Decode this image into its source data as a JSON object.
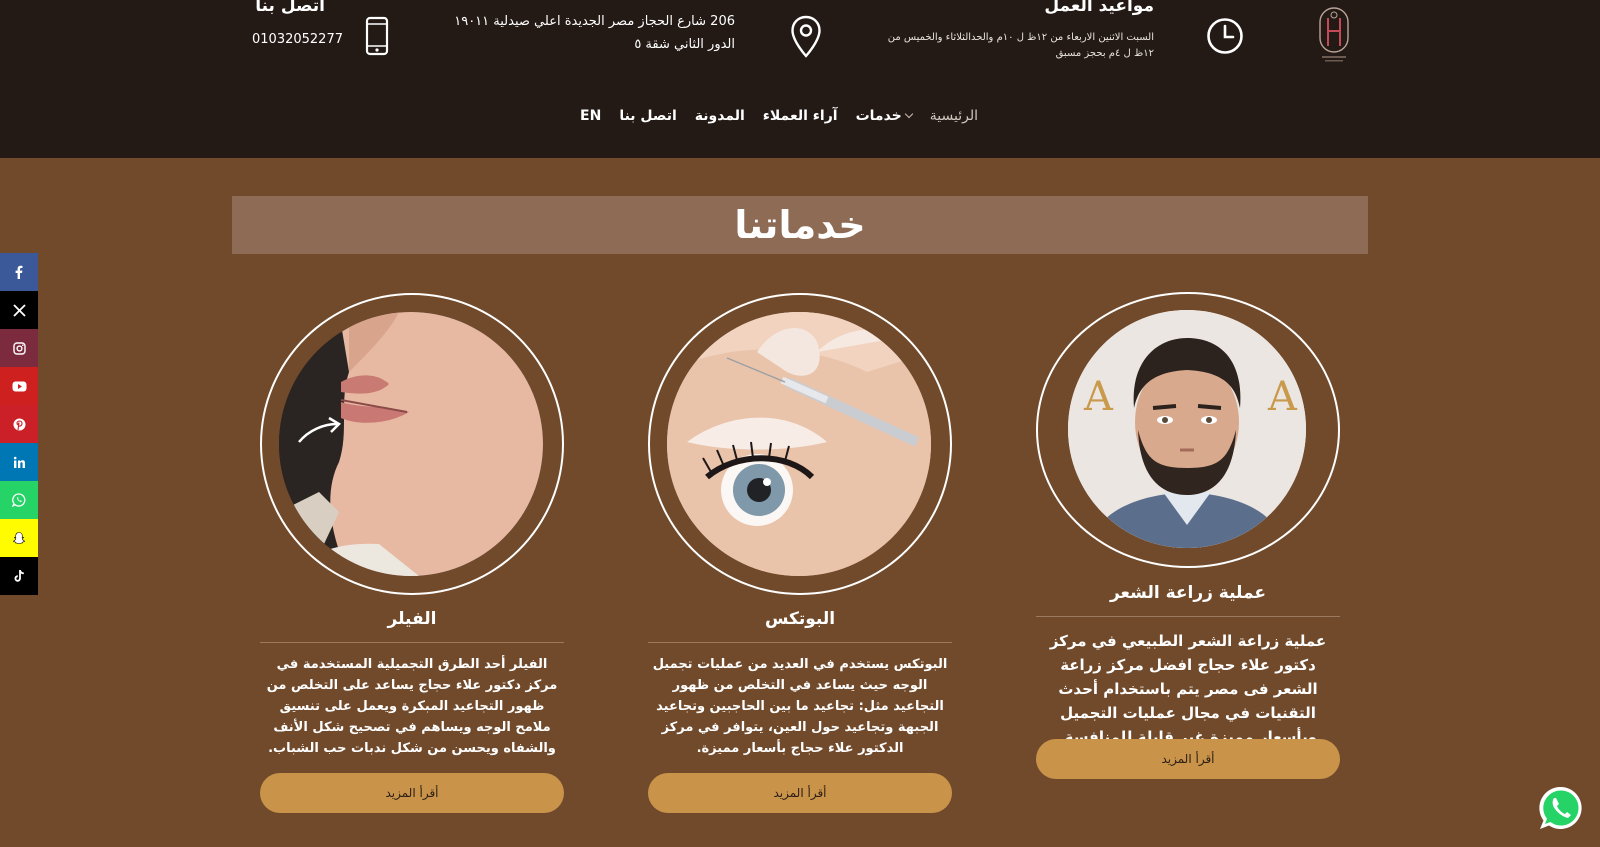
{
  "header": {
    "logo_icon": "clinic-logo-icon",
    "hours": {
      "icon": "clock-icon",
      "title": "مواعيد العمل",
      "line1": "السبت الاثنين الاربعاء من ١٢ظ ل ١٠م والحدالثلاثاء والخميس من",
      "line2": "١٢ظ ل ٤م بحجز مسبق"
    },
    "address": {
      "icon": "location-pin-icon",
      "line1": "206 شارع الحجاز مصر الجديدة اعلي صيدلية ١٩٠١١",
      "line2": "الدور الثاني شقة ٥"
    },
    "contact": {
      "icon": "phone-icon",
      "title": "اتصل بنا",
      "phone": "01032052277"
    }
  },
  "nav": {
    "items": [
      {
        "label": "الرئيسية",
        "active": true
      },
      {
        "label": "خدمات",
        "has_dropdown": true
      },
      {
        "label": "آراء العملاء"
      },
      {
        "label": "المدونة"
      },
      {
        "label": "اتصل بنا"
      },
      {
        "label": "EN"
      }
    ]
  },
  "social": [
    {
      "name": "facebook-icon",
      "color": "#3b5998"
    },
    {
      "name": "x-twitter-icon",
      "color": "#000000"
    },
    {
      "name": "instagram-icon",
      "color": "#7b2b3d"
    },
    {
      "name": "youtube-icon",
      "color": "#cd201f"
    },
    {
      "name": "pinterest-icon",
      "color": "#cb2027"
    },
    {
      "name": "linkedin-icon",
      "color": "#0077b5"
    },
    {
      "name": "whatsapp-icon",
      "color": "#25d366"
    },
    {
      "name": "snapchat-icon",
      "color": "#fffc00"
    },
    {
      "name": "tiktok-icon",
      "color": "#000000"
    }
  ],
  "section": {
    "title": "خدماتنا"
  },
  "cards": [
    {
      "title": "عملية زراعة الشعر",
      "description": "عملية زراعة الشعر الطبيعي في مركز دكتور علاء حجاج افضل مركز زراعة الشعر فى مصر يتم باستخدام أحدث التقنيات في مجال عمليات التجميل وبأسعار مميزة غير قابلة للمنافسة.",
      "button": "أقرأ المزيد"
    },
    {
      "title": "البوتكس",
      "description": "البوتكس يستخدم في العديد من عمليات تجميل الوجه حيث يساعد في التخلص من ظهور التجاعيد مثل: تجاعيد ما بين الحاجبين وتجاعيد الجبهة وتجاعيد حول العين، يتوافر في مركز الدكتور علاء حجاج بأسعار مميزة.",
      "button": "أقرأ المزيد"
    },
    {
      "title": "الفيلر",
      "description": "الفيلر أحد الطرق التجميلية المستخدمة في مركز دكتور علاء حجاج يساعد على التخلص من ظهور التجاعيد المبكرة ويعمل على تنسيق ملامح الوجه ويساهم في تصحيح شكل الأنف والشفاه ويحسن من شكل ندبات حب الشباب.",
      "button": "أقرأ المزيد"
    }
  ],
  "floating": {
    "icon": "whatsapp-float-icon",
    "color": "#25d366"
  }
}
